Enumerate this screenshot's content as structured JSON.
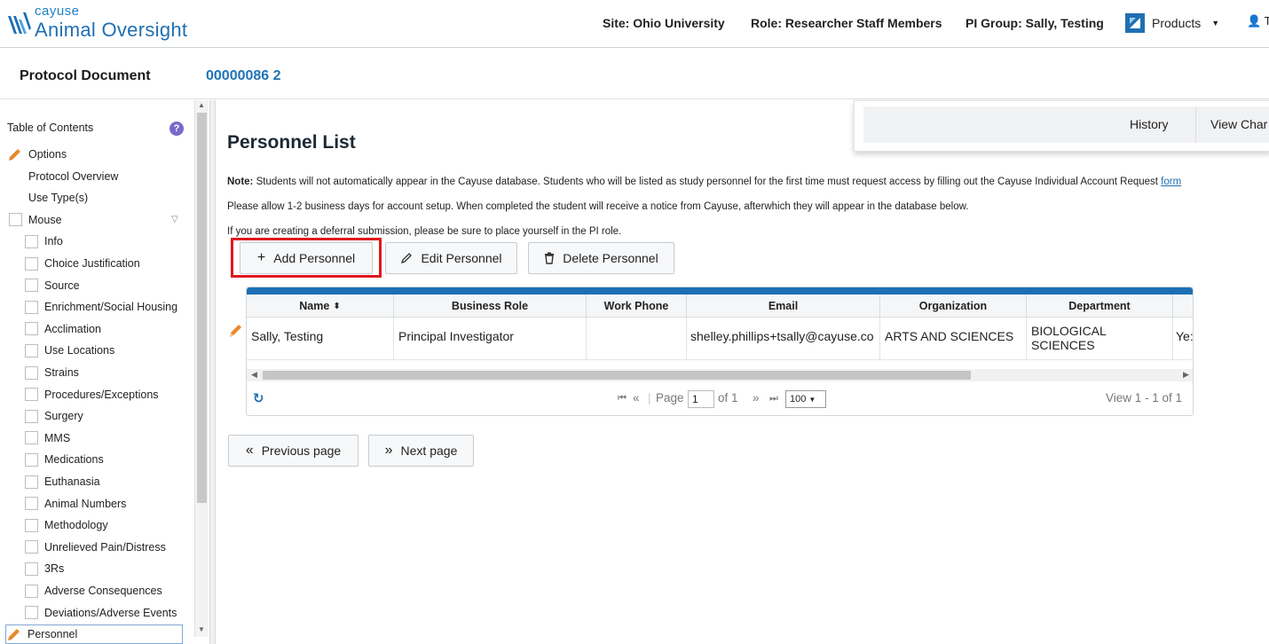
{
  "header": {
    "brand_small": "cayuse",
    "brand_big": "Animal Oversight",
    "site": "Site: Ohio University",
    "role": "Role: Researcher Staff Members",
    "pi_group": "PI Group: Sally, Testing",
    "products": "Products",
    "user_initial": "T"
  },
  "protocol": {
    "label": "Protocol Document",
    "number": "00000086 2"
  },
  "sidebar": {
    "toc_title": "Table of Contents",
    "items": [
      {
        "label": "Options",
        "type": "pencil"
      },
      {
        "label": "Protocol Overview",
        "type": "plain"
      },
      {
        "label": "Use Type(s)",
        "type": "plain"
      },
      {
        "label": "Mouse",
        "type": "checkbox-top"
      },
      {
        "label": "Info",
        "type": "checkbox"
      },
      {
        "label": "Choice Justification",
        "type": "checkbox"
      },
      {
        "label": "Source",
        "type": "checkbox"
      },
      {
        "label": "Enrichment/Social Housing",
        "type": "checkbox"
      },
      {
        "label": "Acclimation",
        "type": "checkbox"
      },
      {
        "label": "Use Locations",
        "type": "checkbox"
      },
      {
        "label": "Strains",
        "type": "checkbox"
      },
      {
        "label": "Procedures/Exceptions",
        "type": "checkbox"
      },
      {
        "label": "Surgery",
        "type": "checkbox"
      },
      {
        "label": "MMS",
        "type": "checkbox"
      },
      {
        "label": "Medications",
        "type": "checkbox"
      },
      {
        "label": "Euthanasia",
        "type": "checkbox"
      },
      {
        "label": "Animal Numbers",
        "type": "checkbox"
      },
      {
        "label": "Methodology",
        "type": "checkbox"
      },
      {
        "label": "Unrelieved Pain/Distress",
        "type": "checkbox"
      },
      {
        "label": "3Rs",
        "type": "checkbox"
      },
      {
        "label": "Adverse Consequences",
        "type": "checkbox"
      },
      {
        "label": "Deviations/Adverse Events",
        "type": "checkbox"
      },
      {
        "label": "Personnel",
        "type": "pencil-active"
      }
    ]
  },
  "history_panel": {
    "history": "History",
    "view_changes": "View Char"
  },
  "main": {
    "title": "Personnel List",
    "note_label": "Note:",
    "note_text": " Students will not automatically appear in the Cayuse database. Students who will be listed as study personnel for the first time must request access by filling out the Cayuse Individual Account Request ",
    "note_link": "form",
    "note_line2": "Please allow 1-2 business days for account setup. When completed the student will receive a notice from Cayuse, afterwhich they will appear in the database below.",
    "note_line3": "If you are creating a deferral submission, please be sure to place yourself in the PI role.",
    "buttons": {
      "add": "Add Personnel",
      "edit": "Edit Personnel",
      "delete": "Delete Personnel"
    },
    "grid": {
      "columns": [
        "Name",
        "Business Role",
        "Work Phone",
        "Email",
        "Organization",
        "Department"
      ],
      "rows": [
        {
          "name": "Sally, Testing",
          "business_role": "Principal Investigator",
          "work_phone": "",
          "email": "shelley.phillips+tsally@cayuse.co",
          "organization": "ARTS AND SCIENCES",
          "department_l1": "BIOLOGICAL",
          "department_l2": "SCIENCES",
          "extra": "Ye:"
        }
      ],
      "pager": {
        "page_label": "Page",
        "page_value": "1",
        "of_label": "of 1",
        "page_size": "100",
        "view_text": "View 1 - 1 of 1"
      }
    },
    "nav": {
      "previous": "Previous page",
      "next": "Next page"
    }
  },
  "colors": {
    "brand_blue": "#1f6fb2",
    "highlight_red": "#e0191e",
    "pencil_orange": "#e8892b"
  }
}
